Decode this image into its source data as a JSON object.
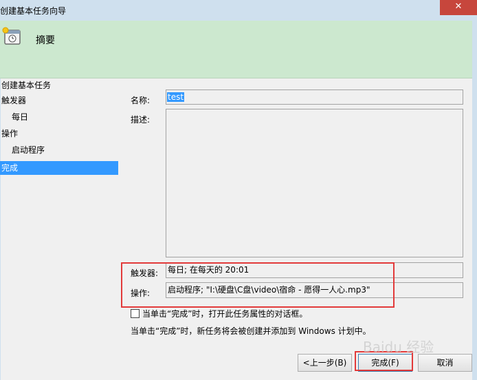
{
  "window": {
    "title": "创建基本任务向导",
    "close_glyph": "✕"
  },
  "header": {
    "title": "摘要"
  },
  "nav": {
    "items": [
      {
        "label": "创建基本任务",
        "indent": false,
        "active": false
      },
      {
        "label": "触发器",
        "indent": false,
        "active": false
      },
      {
        "label": "每日",
        "indent": true,
        "active": false
      },
      {
        "label": "操作",
        "indent": false,
        "active": false
      },
      {
        "label": "启动程序",
        "indent": true,
        "active": false
      },
      {
        "label": "完成",
        "indent": false,
        "active": true
      }
    ]
  },
  "form": {
    "name_label": "名称:",
    "name_value": "test",
    "desc_label": "描述:",
    "desc_value": "",
    "trigger_label": "触发器:",
    "trigger_value": "每日; 在每天的 20:01",
    "action_label": "操作:",
    "action_value": "启动程序; \"I:\\硬盘\\C盘\\video\\宿命 - 愿得一人心.mp3\"",
    "checkbox_label": "当单击“完成”时，打开此任务属性的对话框。",
    "checkbox_checked": false,
    "info_text": "当单击“完成”时，新任务将会被创建并添加到 Windows 计划中。"
  },
  "buttons": {
    "back": "<上一步(B)",
    "finish": "完成(F)",
    "cancel": "取消"
  },
  "watermark": "Baidu 经验",
  "colors": {
    "selection": "#3399ff",
    "header_bg": "#cce8cf",
    "highlight_box": "#e23a3a",
    "close_btn": "#c7463c"
  }
}
